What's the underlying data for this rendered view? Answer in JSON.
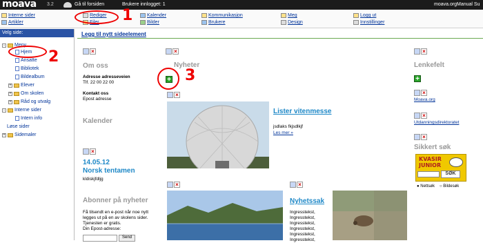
{
  "topbar": {
    "logo": "moava",
    "version": "3.2",
    "home_link": "Gå til forsiden",
    "users_logged": "Brukere innlogget: 1",
    "site": "moava.org",
    "user": "Manual Su"
  },
  "menu": {
    "items": [
      {
        "label": "Interne sider"
      },
      {
        "label": "Artikler"
      },
      {
        "label": "Rediger"
      },
      {
        "label": "Filer"
      },
      {
        "label": "Kalender"
      },
      {
        "label": "Bilder"
      },
      {
        "label": "Kommunikasjon"
      },
      {
        "label": "Brukere"
      },
      {
        "label": "Meg"
      },
      {
        "label": "Design"
      },
      {
        "label": "Logg ut"
      },
      {
        "label": "Innstillinger"
      }
    ]
  },
  "sidebar": {
    "header": "Velg side:",
    "tree": [
      {
        "label": "Meny"
      },
      {
        "label": "Hjem"
      },
      {
        "label": "Ansatte"
      },
      {
        "label": "Bibliotek"
      },
      {
        "label": "Bildealbum"
      },
      {
        "label": "Elever"
      },
      {
        "label": "Om skolen"
      },
      {
        "label": "Råd og utvalg"
      },
      {
        "label": "Interne sider"
      },
      {
        "label": "Intern info"
      },
      {
        "label": "Løse sider"
      },
      {
        "label": "Sidemaler"
      }
    ]
  },
  "content": {
    "add_element": "Legg til nytt sideelement",
    "om_oss": {
      "title": "Om oss",
      "addr_label": "Adresse adresseveien",
      "phone": "Tlf. 22 00 22 00",
      "contact_label": "Kontakt oss",
      "email": "Epost adresse"
    },
    "kalender": {
      "title": "Kalender",
      "date": "14.05.12",
      "event": "Norsk tentamen",
      "desc": "kldiskjfdljg"
    },
    "abonner": {
      "title": "Abonner på nyheter",
      "text": "Få tilsendt en e-post når noe nytt legges ut på en av skolens sider. Tjenesten er gratis.",
      "email_label": "Din Epost-adresse:",
      "send": "Send"
    },
    "nyheter": {
      "title": "Nyheter",
      "item1_title": "Lister vitenmesse",
      "item1_text": "jsdlaks fkjsdlkjf",
      "item1_more": "Les mer »",
      "item2_title": "Nyhetssak",
      "item2_lines": [
        "Ingresstekst,",
        "Ingresstekst,",
        "Ingresstekst,",
        "Ingresstekst,",
        "Ingresstekst,",
        "Ingresstekst,"
      ]
    },
    "lenkefelt": {
      "title": "Lenkefelt",
      "link1": "Moava.org",
      "link2": "Utdanningsdirektoratet"
    },
    "sikkert": {
      "title": "Sikkert søk",
      "logo_text1": "KVASIR",
      "logo_text2": "JUNIOR",
      "search_button": "SØK",
      "opt1": "Nettsøk",
      "opt2": "Bildesøk"
    }
  },
  "annotations": {
    "n1": "1",
    "n2": "2",
    "n3": "3"
  },
  "colors": {
    "topbar": "#1b1b1b",
    "sidebar_header": "#2a53a5",
    "heading_blue": "#1e88c7",
    "annotation_red": "#e00000"
  }
}
